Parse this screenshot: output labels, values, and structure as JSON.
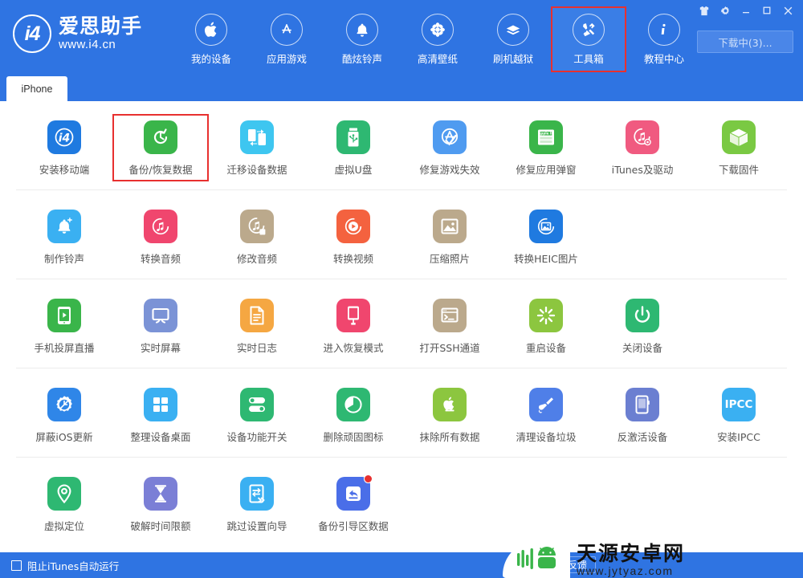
{
  "brand": {
    "logo_text": "i4",
    "name_cn": "爱思助手",
    "url": "www.i4.cn",
    "logo_icon": "i4-circle-logo"
  },
  "header": {
    "nav_items": [
      {
        "label": "我的设备",
        "icon": "apple-icon",
        "selected": false
      },
      {
        "label": "应用游戏",
        "icon": "appstore-icon",
        "selected": false
      },
      {
        "label": "酷炫铃声",
        "icon": "bell-icon",
        "selected": false
      },
      {
        "label": "高清壁纸",
        "icon": "flower-wallpaper-icon",
        "selected": false
      },
      {
        "label": "刷机越狱",
        "icon": "package-box-icon",
        "selected": false
      },
      {
        "label": "工具箱",
        "icon": "tools-wrench-icon",
        "selected": true
      },
      {
        "label": "教程中心",
        "icon": "info-icon",
        "selected": false
      }
    ],
    "window_controls": [
      {
        "name": "skin-shirt-icon",
        "glyph": "skin"
      },
      {
        "name": "settings-gear-icon",
        "glyph": "gear"
      },
      {
        "name": "minimize-icon",
        "glyph": "minimize"
      },
      {
        "name": "maximize-icon",
        "glyph": "maximize"
      },
      {
        "name": "close-icon",
        "glyph": "close"
      }
    ],
    "download_button": "下载中(3)..."
  },
  "tabs": [
    {
      "label": "iPhone",
      "active": true
    }
  ],
  "toolbox": {
    "rows": [
      {
        "tools": [
          {
            "label": "安装移动端",
            "icon": "i4-app-icon",
            "color": "#1f7ae0",
            "selected": false,
            "badge": false
          },
          {
            "label": "备份/恢复数据",
            "icon": "backup-restore-icon",
            "color": "#3ab54a",
            "selected": true,
            "badge": false
          },
          {
            "label": "迁移设备数据",
            "icon": "device-migrate-icon",
            "color": "#3ec6f0",
            "selected": false,
            "badge": false
          },
          {
            "label": "虚拟U盘",
            "icon": "usb-drive-icon",
            "color": "#2eb872",
            "selected": false,
            "badge": false
          },
          {
            "label": "修复游戏失效",
            "icon": "appstore-fix-icon",
            "color": "#4f9bf0",
            "selected": false,
            "badge": false
          },
          {
            "label": "修复应用弹窗",
            "icon": "appleid-card-icon",
            "color": "#3ab54a",
            "selected": false,
            "badge": false
          },
          {
            "label": "iTunes及驱动",
            "icon": "itunes-driver-icon",
            "color": "#f05a80",
            "selected": false,
            "badge": false
          },
          {
            "label": "下载固件",
            "icon": "firmware-box-icon",
            "color": "#7ac943",
            "selected": false,
            "badge": false
          }
        ]
      },
      {
        "tools": [
          {
            "label": "制作铃声",
            "icon": "ringtone-make-icon",
            "color": "#3ab0f2",
            "selected": false,
            "badge": false
          },
          {
            "label": "转换音频",
            "icon": "audio-convert-icon",
            "color": "#f0466e",
            "selected": false,
            "badge": false
          },
          {
            "label": "修改音频",
            "icon": "audio-edit-icon",
            "color": "#bba98c",
            "selected": false,
            "badge": false
          },
          {
            "label": "转换视频",
            "icon": "video-convert-icon",
            "color": "#f4623f",
            "selected": false,
            "badge": false
          },
          {
            "label": "压缩照片",
            "icon": "photo-compress-icon",
            "color": "#bba98c",
            "selected": false,
            "badge": false
          },
          {
            "label": "转换HEIC图片",
            "icon": "heic-convert-icon",
            "color": "#1f7ae0",
            "selected": false,
            "badge": false
          }
        ]
      },
      {
        "tools": [
          {
            "label": "手机投屏直播",
            "icon": "screen-cast-icon",
            "color": "#3ab54a",
            "selected": false,
            "badge": false
          },
          {
            "label": "实时屏幕",
            "icon": "realtime-screen-icon",
            "color": "#7b93d6",
            "selected": false,
            "badge": false
          },
          {
            "label": "实时日志",
            "icon": "realtime-log-icon",
            "color": "#f5a742",
            "selected": false,
            "badge": false
          },
          {
            "label": "进入恢复模式",
            "icon": "recovery-mode-icon",
            "color": "#f0466e",
            "selected": false,
            "badge": false
          },
          {
            "label": "打开SSH通道",
            "icon": "ssh-terminal-icon",
            "color": "#bba98c",
            "selected": false,
            "badge": false
          },
          {
            "label": "重启设备",
            "icon": "restart-device-icon",
            "color": "#8cc63f",
            "selected": false,
            "badge": false
          },
          {
            "label": "关闭设备",
            "icon": "power-off-icon",
            "color": "#2eb872",
            "selected": false,
            "badge": false
          }
        ]
      },
      {
        "tools": [
          {
            "label": "屏蔽iOS更新",
            "icon": "block-ios-update-icon",
            "color": "#2f86e8",
            "selected": false,
            "badge": false
          },
          {
            "label": "整理设备桌面",
            "icon": "organize-desktop-icon",
            "color": "#3ab0f2",
            "selected": false,
            "badge": false
          },
          {
            "label": "设备功能开关",
            "icon": "feature-toggle-icon",
            "color": "#2eb872",
            "selected": false,
            "badge": false
          },
          {
            "label": "删除顽固图标",
            "icon": "remove-icon-icon",
            "color": "#2eb872",
            "selected": false,
            "badge": false
          },
          {
            "label": "抹除所有数据",
            "icon": "erase-all-icon",
            "color": "#8cc63f",
            "selected": false,
            "badge": false
          },
          {
            "label": "清理设备垃圾",
            "icon": "clean-junk-icon",
            "color": "#4f7fe8",
            "selected": false,
            "badge": false
          },
          {
            "label": "反激活设备",
            "icon": "deactivate-device-icon",
            "color": "#6b7fd1",
            "selected": false,
            "badge": false
          },
          {
            "label": "安装IPCC",
            "icon": "ipcc-install-icon",
            "color": "#3ab0f2",
            "selected": false,
            "badge": false,
            "text": "IPCC"
          }
        ]
      },
      {
        "tools": [
          {
            "label": "虚拟定位",
            "icon": "virtual-location-icon",
            "color": "#2eb872",
            "selected": false,
            "badge": false
          },
          {
            "label": "破解时间限额",
            "icon": "hourglass-icon",
            "color": "#7b7fd6",
            "selected": false,
            "badge": false
          },
          {
            "label": "跳过设置向导",
            "icon": "skip-setup-icon",
            "color": "#3ab0f2",
            "selected": false,
            "badge": false
          },
          {
            "label": "备份引导区数据",
            "icon": "backup-boot-icon",
            "color": "#4a6ee8",
            "selected": false,
            "badge": true
          }
        ]
      }
    ]
  },
  "statusbar": {
    "checkbox_label": "阻止iTunes自动运行",
    "checkbox_checked": false,
    "feedback_button": "意见反馈"
  },
  "watermark": {
    "name_cn": "天源安卓网",
    "url": "www.jytyaz.com",
    "icon": "android-robot-icon"
  },
  "colors": {
    "header_blue": "#2f74e2",
    "accent_red": "#e8302f",
    "content_white": "#ffffff",
    "tab_active": "#ffffff"
  }
}
